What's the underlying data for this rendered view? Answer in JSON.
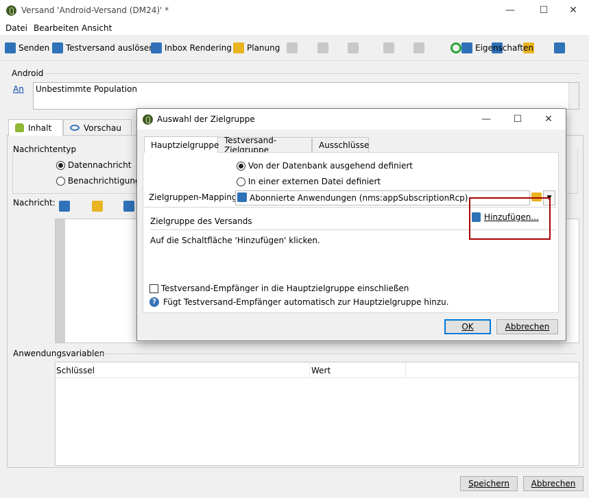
{
  "window": {
    "title": "Versand 'Android-Versand (DM24)' *"
  },
  "menu": [
    "Datei",
    "Bearbeiten",
    "Ansicht"
  ],
  "toolbar": {
    "send": "Senden",
    "proof": "Testversand auslösen",
    "inbox": "Inbox Rendering",
    "schedule": "Planung",
    "properties": "Eigenschaften"
  },
  "android_group": {
    "label": "Android",
    "to_link": "An",
    "population": "Unbestimmte Population"
  },
  "tabs": {
    "content": "Inhalt",
    "preview": "Vorschau"
  },
  "message_type": {
    "label": "Nachrichtentyp",
    "data": "Datennachricht",
    "notification": "Benachrichtigungsi"
  },
  "message_label": "Nachricht:",
  "app_vars": {
    "label": "Anwendungsvariablen",
    "col_key": "Schlüssel",
    "col_value": "Wert"
  },
  "footer": {
    "save": "Speichern",
    "cancel": "Abbrechen"
  },
  "dialog": {
    "title": "Auswahl der Zielgruppe",
    "tabs": [
      "Hauptzielgruppe",
      "Testversand-Zielgruppe",
      "Ausschlüsse"
    ],
    "radio_db": "Von der Datenbank ausgehend definiert",
    "radio_file": "In einer externen Datei definiert",
    "mapping_label": "Zielgruppen-Mapping:",
    "mapping_value": "Abonnierte Anwendungen (nms:appSubscriptionRcp)",
    "target_label": "Zielgruppe des Versands",
    "add_button": "Hinzufügen...",
    "hint": "Auf die Schaltfläche 'Hinzufügen' klicken.",
    "include_proof": "Testversand-Empfänger in die Hauptzielgruppe einschließen",
    "info": "Fügt Testversand-Empfänger automatisch zur Hauptzielgruppe hinzu.",
    "ok": "OK",
    "cancel": "Abbrechen"
  },
  "colors": {
    "accent": "#0078d7",
    "highlight": "#a80000"
  }
}
